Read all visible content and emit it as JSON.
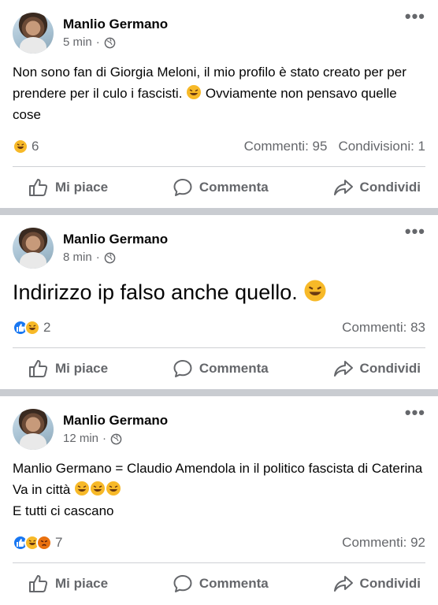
{
  "posts": [
    {
      "author": "Manlio Germano",
      "time": "5 min",
      "text_before": "Non sono fan di Giorgia Meloni, il mio profilo è stato creato per per prendere per il culo i fascisti. ",
      "text_after": " Ovviamente non pensavo quelle cose",
      "reaction_count": "6",
      "comments": "Commenti: 95",
      "shares": "Condivisioni: 1"
    },
    {
      "author": "Manlio Germano",
      "time": "8 min",
      "text_before": "Indirizzo ip falso anche quello. ",
      "reaction_count": "2",
      "comments": "Commenti: 83"
    },
    {
      "author": "Manlio Germano",
      "time": "12 min",
      "text_before": "Manlio Germano = Claudio Amendola in il politico fascista di Caterina Va in città ",
      "text_line2": "E tutti ci cascano",
      "reaction_count": "7",
      "comments": "Commenti: 92"
    }
  ],
  "actions": {
    "like": "Mi piace",
    "comment": "Commenta",
    "share": "Condividi"
  },
  "colors": {
    "like_blue": "#1877f2",
    "haha_yellow": "#f7b928",
    "angry_orange": "#e9710f",
    "grey_text": "#65676b"
  }
}
